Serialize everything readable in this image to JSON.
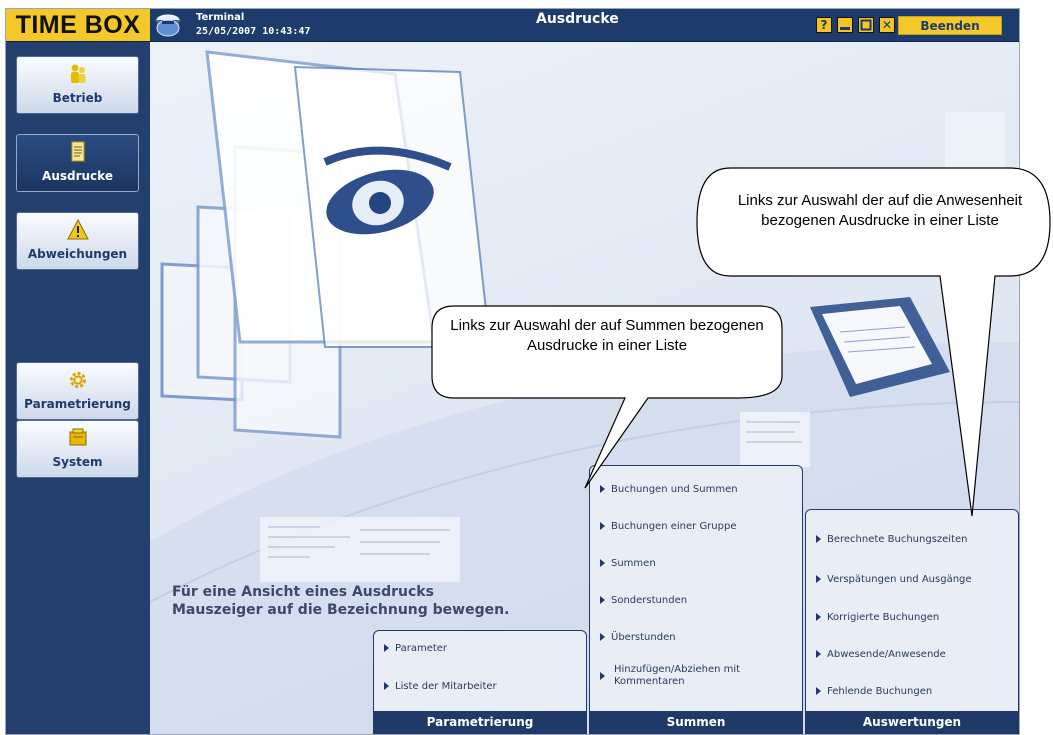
{
  "app": {
    "logo": "TIME BOX",
    "terminal_name": "Terminal",
    "terminal_datetime": "25/05/2007 10:43:47",
    "page_title": "Ausdrucke",
    "help_glyph": "?",
    "close_glyph": "✕",
    "quit_label": "Beenden"
  },
  "sidebar": {
    "items": [
      {
        "label": "Betrieb",
        "icon": "people-icon",
        "active": false
      },
      {
        "label": "Ausdrucke",
        "icon": "document-icon",
        "active": true
      },
      {
        "label": "Abweichungen",
        "icon": "warning-icon",
        "active": false
      },
      {
        "label": "Parametrierung",
        "icon": "gear-icon",
        "active": false
      },
      {
        "label": "System",
        "icon": "folder-icon",
        "active": false
      }
    ]
  },
  "main": {
    "hint_line1": "Für eine Ansicht eines Ausdrucks",
    "hint_line2": "Mauszeiger auf die Bezeichnung bewegen."
  },
  "panels": {
    "parametrierung": {
      "title": "Parametrierung",
      "items": [
        "Parameter",
        "Liste der Mitarbeiter"
      ]
    },
    "summen": {
      "title": "Summen",
      "items": [
        "Buchungen und Summen",
        "Buchungen einer Gruppe",
        "Summen",
        "Sonderstunden",
        "Überstunden",
        "Hinzufügen/Abziehen mit Kommentaren"
      ]
    },
    "auswertungen": {
      "title": "Auswertungen",
      "items": [
        "Berechnete Buchungszeiten",
        "Verspätungen und Ausgänge",
        "Korrigierte Buchungen",
        "Abwesende/Anwesende",
        "Fehlende Buchungen"
      ]
    }
  },
  "callouts": {
    "summen": "Links zur Auswahl der auf Summen bezogenen Ausdrucke in einer Liste",
    "anwesenheit": "Links zur Auswahl der auf die Anwesenheit bezogenen Ausdrucke in einer Liste"
  },
  "colors": {
    "navy": "#1f3a66",
    "yellow": "#f4c82a",
    "panel_bg": "#e9eef6"
  }
}
